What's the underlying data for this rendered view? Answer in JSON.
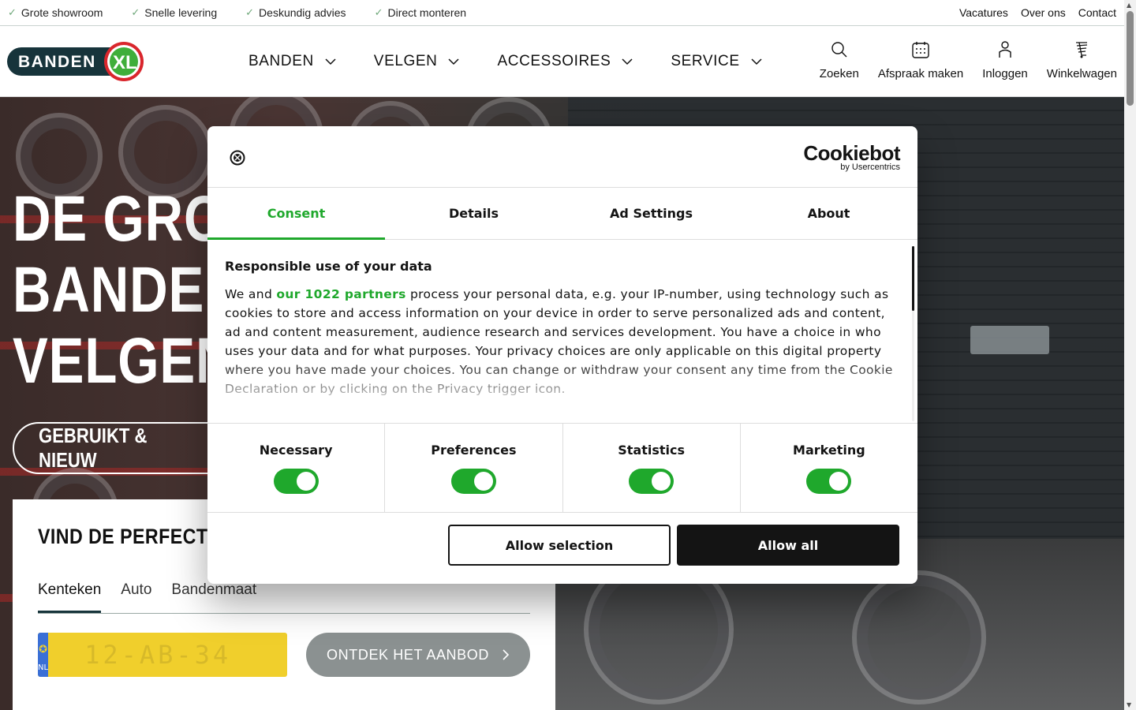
{
  "topbar": {
    "usps": [
      "Grote showroom",
      "Snelle levering",
      "Deskundig advies",
      "Direct monteren"
    ],
    "links": [
      "Vacatures",
      "Over ons",
      "Contact"
    ]
  },
  "header": {
    "logo_text": "BANDEN",
    "logo_badge": "XL",
    "nav": [
      "BANDEN",
      "VELGEN",
      "ACCESSOIRES",
      "SERVICE"
    ],
    "tools": [
      {
        "label": "Zoeken",
        "icon": "search-icon"
      },
      {
        "label": "Afspraak maken",
        "icon": "calendar-icon"
      },
      {
        "label": "Inloggen",
        "icon": "user-icon"
      },
      {
        "label": "Winkelwagen",
        "icon": "cart-icon"
      }
    ]
  },
  "hero": {
    "title_lines": [
      "DE GRO",
      "BANDE",
      "VELGEN"
    ],
    "pill": "GEBRUIKT & NIEUW"
  },
  "finder": {
    "title": "VIND DE PERFECTE B",
    "tabs": [
      "Kenteken",
      "Auto",
      "Bandenmaat"
    ],
    "active_tab": "Kenteken",
    "plate_country": "NL",
    "plate_placeholder": "12-AB-34",
    "cta": "ONTDEK HET AANBOD"
  },
  "cookie": {
    "brand": "Cookiebot",
    "brand_sub": "by Usercentrics",
    "tabs": [
      "Consent",
      "Details",
      "Ad Settings",
      "About"
    ],
    "active_tab": "Consent",
    "heading": "Responsible use of your data",
    "text_before_link": "We and ",
    "link_text": "our 1022 partners",
    "text_after_link": " process your personal data, e.g. your IP-number, using technology such as cookies to store and access information on your device in order to serve personalized ads and content, ad and content measurement, audience research and services development. You have a choice in who uses your data and for what purposes. Your privacy choices are only applicable on this digital property where you have made your choices. You can change or withdraw your consent any time from the Cookie Declaration or by clicking on the Privacy trigger icon.",
    "toggles": [
      {
        "label": "Necessary",
        "on": true
      },
      {
        "label": "Preferences",
        "on": true
      },
      {
        "label": "Statistics",
        "on": true
      },
      {
        "label": "Marketing",
        "on": true
      }
    ],
    "btn_selection": "Allow selection",
    "btn_all": "Allow all"
  },
  "colors": {
    "accent_green": "#1fa82c",
    "dark": "#141414",
    "plate_yellow": "#f0cf2c"
  }
}
